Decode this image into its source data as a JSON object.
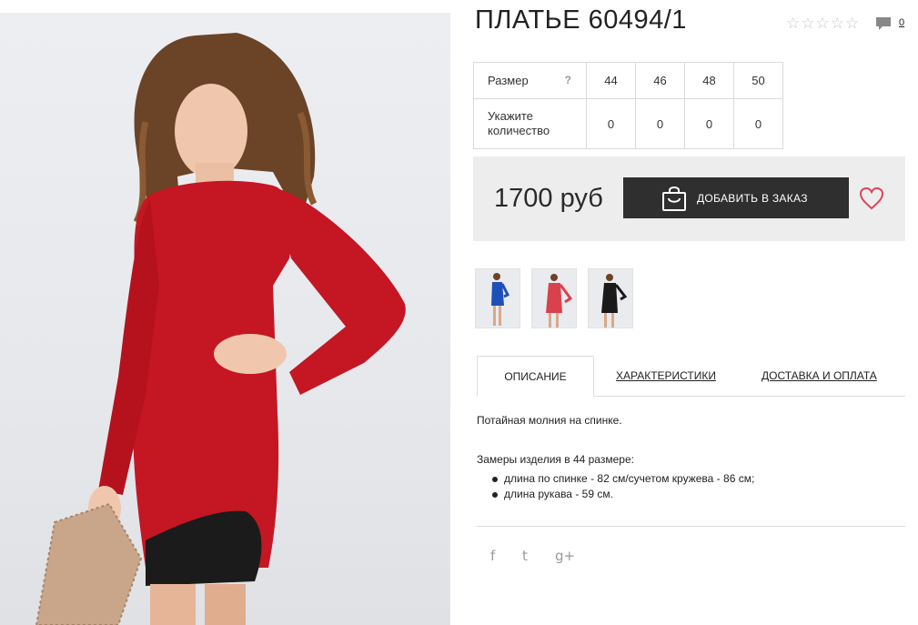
{
  "product": {
    "title": "ПЛАТЬЕ 60494/1",
    "rating_stars": "☆☆☆☆☆",
    "comment_count": "0"
  },
  "sizes": {
    "size_label": "Размер",
    "help": "?",
    "values": [
      "44",
      "46",
      "48",
      "50"
    ],
    "qty_label": "Укажите количество",
    "quantities": [
      "0",
      "0",
      "0",
      "0"
    ]
  },
  "order": {
    "price": "1700 руб",
    "add_button": "ДОБАВИТЬ В ЗАКАЗ"
  },
  "thumbnails": [
    {
      "name": "blue-dress-thumbnail",
      "color": "#1f4fb8"
    },
    {
      "name": "red-dress-thumbnail",
      "color": "#d9424c"
    },
    {
      "name": "black-dress-thumbnail",
      "color": "#1a1a1a"
    }
  ],
  "tabs": {
    "description": "ОПИСАНИЕ",
    "specs": "ХАРАКТЕРИСТИКИ",
    "delivery": "ДОСТАВКА И ОПЛАТА"
  },
  "description": {
    "line1": "Потайная молния на спинке.",
    "line2": "Замеры изделия в 44 размере:",
    "bullets": [
      "длина по спинке - 82 см/сучетом кружева - 86 см;",
      "длина рукава - 59 см."
    ]
  },
  "social": {
    "facebook": "f",
    "twitter": "t",
    "googleplus": "g+"
  },
  "colors": {
    "dress_red": "#c41623",
    "button_dark": "#2f2f2f",
    "heart": "#d6475a"
  }
}
